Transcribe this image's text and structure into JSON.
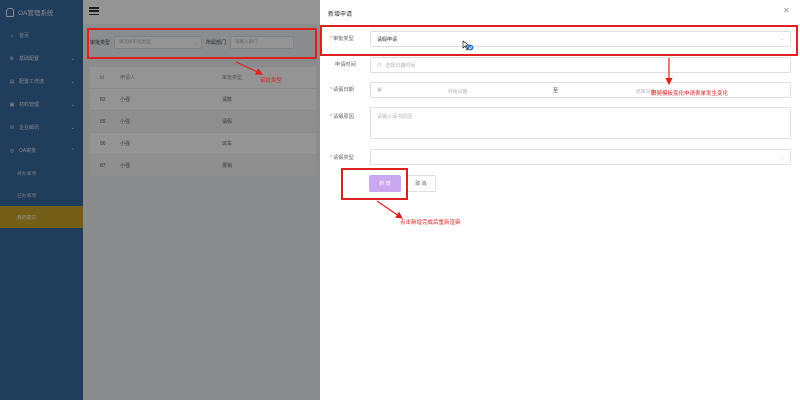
{
  "app": {
    "title": "OA管理系统"
  },
  "sidebar": {
    "items": [
      {
        "label": "首页",
        "icon": "home-icon",
        "glyph": "⌂"
      },
      {
        "label": "基础配置",
        "icon": "gear-icon",
        "glyph": "⚙"
      },
      {
        "label": "配置工作流",
        "icon": "workflow-icon",
        "glyph": "▤"
      },
      {
        "label": "材料管理",
        "icon": "material-icon",
        "glyph": "▣"
      },
      {
        "label": "企业邮讯",
        "icon": "mail-icon",
        "glyph": "✉"
      },
      {
        "label": "OA审批",
        "icon": "approval-icon",
        "glyph": "◎"
      }
    ],
    "sub_items": [
      {
        "label": "待办事项"
      },
      {
        "label": "已办事项"
      },
      {
        "label": "我的提交",
        "active": true
      }
    ]
  },
  "filter": {
    "type_label": "审批类型",
    "type_placeholder": "请选择审批类型",
    "dept_label": "所属部门",
    "dept_placeholder": "请输入部门"
  },
  "table": {
    "headers": [
      "id",
      "申请人",
      "审批类型"
    ],
    "rows": [
      {
        "id": "82",
        "name": "小强",
        "type": "请款"
      },
      {
        "id": "85",
        "name": "小强",
        "type": "请假"
      },
      {
        "id": "86",
        "name": "小强",
        "type": "派车"
      },
      {
        "id": "87",
        "name": "小强",
        "type": "报销"
      }
    ]
  },
  "drawer": {
    "title": "新增申请",
    "approval_type_label": "审批类型",
    "approval_type_value": "请假申请",
    "apply_time_label": "申请时间",
    "apply_time_placeholder": "选择日期时间",
    "leave_date_label": "请假日期",
    "start_placeholder": "开始日期",
    "range_separator": "至",
    "end_placeholder": "结束日期",
    "reason_label": "请假原因",
    "reason_placeholder": "请输入请书原因",
    "leave_type_label": "请假类型",
    "submit_label": "新 增",
    "cancel_label": "取 消"
  },
  "annotations": {
    "filter_note": "审批类型",
    "form_note": "跟随模板变化申请表单发生变化",
    "button_note": "点击新增完成后重新渲染"
  },
  "colors": {
    "sidebar": "#3a6a9f",
    "active_item": "#c8a32a",
    "primary_button": "#c9a8f0",
    "annotation": "#e0201f",
    "required": "#f56c6c"
  }
}
